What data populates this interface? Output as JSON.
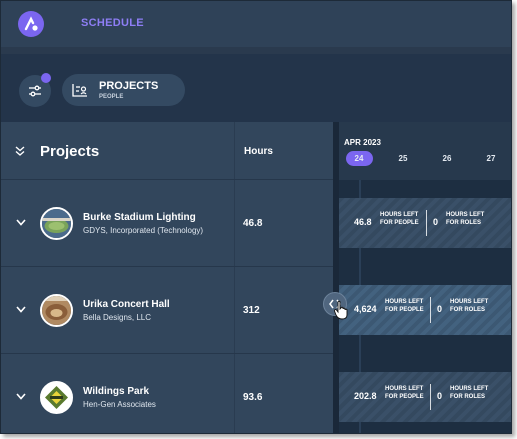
{
  "header": {
    "title": "SCHEDULE"
  },
  "toolbar": {
    "view_title": "PROJECTS",
    "view_subtitle": "PEOPLE"
  },
  "grid": {
    "column_projects": "Projects",
    "column_hours": "Hours"
  },
  "timeline": {
    "month": "APR 2023",
    "days": [
      "24",
      "25",
      "26",
      "27"
    ],
    "selected_day": "24"
  },
  "rows": [
    {
      "name": "Burke Stadium Lighting",
      "client": "GDYS, Incorporated (Technology)",
      "hours": "46.8",
      "people_hours": "46.8",
      "people_label": "HOURS LEFT FOR PEOPLE",
      "role_hours": "0",
      "role_label": "HOURS LEFT FOR ROLES"
    },
    {
      "name": "Urika Concert Hall",
      "client": "Bella Designs, LLC",
      "hours": "312",
      "people_hours": "4,624",
      "people_label": "HOURS LEFT FOR PEOPLE",
      "role_hours": "0",
      "role_label": "HOURS LEFT FOR ROLES"
    },
    {
      "name": "Wildings Park",
      "client": "Hen-Gen Associates",
      "hours": "93.6",
      "people_hours": "202.8",
      "people_label": "HOURS LEFT FOR PEOPLE",
      "role_hours": "0",
      "role_label": "HOURS LEFT FOR ROLES"
    }
  ],
  "colors": {
    "accent": "#7b66f0",
    "background": "#2a3a4e"
  }
}
